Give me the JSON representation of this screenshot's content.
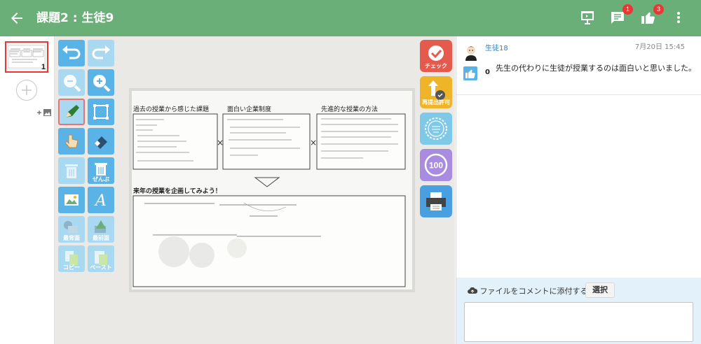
{
  "header": {
    "title": "課題2 : 生徒9",
    "comment_badge": "1",
    "like_badge": "3",
    "bg_color": "#6aae78"
  },
  "thumbnails": {
    "pages": [
      {
        "number": "1",
        "selected": true
      }
    ]
  },
  "tools": {
    "delete_all_label": "ぜんぶ",
    "bring_back_label": "最背面",
    "bring_front_label": "最前面",
    "copy_label": "コピー",
    "paste_label": "ペースト"
  },
  "side_actions": {
    "check_label": "チェック",
    "resubmit_label": "再提出許可",
    "score_label": "100"
  },
  "worksheet": {
    "heading_left": "過去の授業から感じた課題",
    "heading_mid": "面白い企業制度",
    "heading_right": "先進的な授業の方法",
    "prompt": "来年の授業を企画してみよう！"
  },
  "comment": {
    "user_name": "生徒18",
    "timestamp": "7月20日 15:45",
    "like_count": "0",
    "text": "先生の代わりに生徒が授業するのは面白いと思いました。"
  },
  "attach": {
    "label": "ファイルをコメントに添付する",
    "select_label": "選択",
    "comment_value": ""
  },
  "colors": {
    "accent_blue": "#5ab3e6",
    "light_blue": "#a9d8f1",
    "check_red": "#e45a4c",
    "resubmit_orange": "#f0b429",
    "stamp_blue": "#7ec8e8",
    "score_purple": "#a98be0",
    "print_blue": "#4a9fe0"
  }
}
